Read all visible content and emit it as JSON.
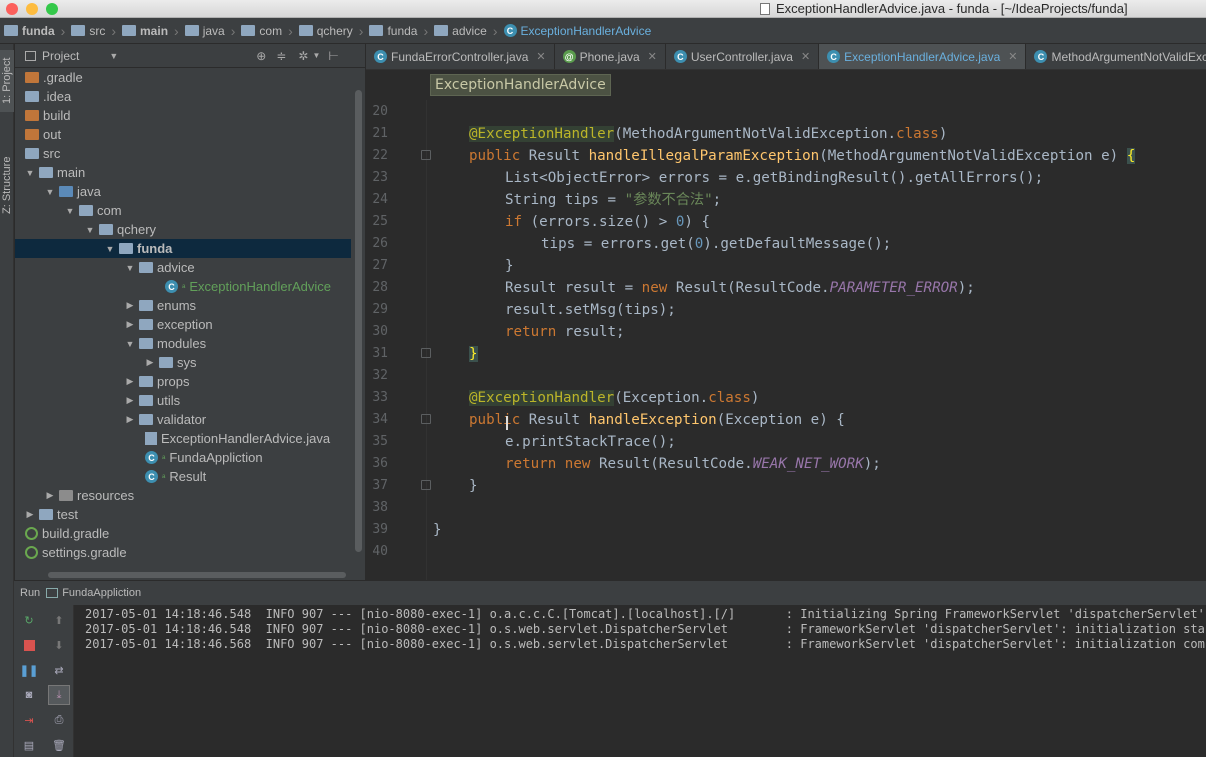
{
  "window": {
    "title": "ExceptionHandlerAdvice.java - funda - [~/IdeaProjects/funda]"
  },
  "breadcrumbs": [
    "funda",
    "src",
    "main",
    "java",
    "com",
    "qchery",
    "funda",
    "advice",
    "ExceptionHandlerAdvice"
  ],
  "left_strip": {
    "project_tab": "1: Project",
    "structure_tab": "Z: Structure"
  },
  "project_panel": {
    "title": "Project"
  },
  "tree": [
    {
      "label": ".gradle"
    },
    {
      "label": ".idea"
    },
    {
      "label": "build"
    },
    {
      "label": "out"
    },
    {
      "label": "src"
    },
    {
      "label": "main"
    },
    {
      "label": "java"
    },
    {
      "label": "com"
    },
    {
      "label": "qchery"
    },
    {
      "label": "funda"
    },
    {
      "label": "advice"
    },
    {
      "label": "ExceptionHandlerAdvice"
    },
    {
      "label": "enums"
    },
    {
      "label": "exception"
    },
    {
      "label": "modules"
    },
    {
      "label": "sys"
    },
    {
      "label": "props"
    },
    {
      "label": "utils"
    },
    {
      "label": "validator"
    },
    {
      "label": "ExceptionHandlerAdvice.java"
    },
    {
      "label": "FundaAppliction"
    },
    {
      "label": "Result"
    },
    {
      "label": "resources"
    },
    {
      "label": "test"
    },
    {
      "label": "build.gradle"
    },
    {
      "label": "settings.gradle"
    }
  ],
  "tabs": [
    "FundaErrorController.java",
    "Phone.java",
    "UserController.java",
    "ExceptionHandlerAdvice.java",
    "MethodArgumentNotValidExceptio"
  ],
  "editor": {
    "class_crumb": "ExceptionHandlerAdvice"
  },
  "line_numbers": [
    "20",
    "21",
    "22",
    "23",
    "24",
    "25",
    "26",
    "27",
    "28",
    "29",
    "30",
    "31",
    "32",
    "33",
    "34",
    "35",
    "36",
    "37",
    "38",
    "39",
    "40"
  ],
  "code": {
    "l21_ann": "@ExceptionHandler",
    "l21_rest": "(MethodArgumentNotValidException.",
    "l21_kw": "class",
    "l21_end": ")",
    "l22_kw": "public",
    "l22_a": " Result ",
    "l22_fn": "handleIllegalParamException",
    "l22_b": "(MethodArgumentNotValidException e) ",
    "l22_brace": "{",
    "l23": "List<ObjectError> errors = e.getBindingResult().getAllErrors();",
    "l24_a": "String tips = ",
    "l24_str": "\"参数不合法\"",
    "l24_b": ";",
    "l25_kw": "if",
    "l25_a": " (errors.size() > ",
    "l25_num": "0",
    "l25_b": ") {",
    "l26_a": "tips = errors.get(",
    "l26_num": "0",
    "l26_b": ").getDefaultMessage();",
    "l27": "}",
    "l28_a": "Result result = ",
    "l28_kw": "new",
    "l28_b": " Result(ResultCode.",
    "l28_st": "PARAMETER_ERROR",
    "l28_c": ");",
    "l29": "result.setMsg(tips);",
    "l30_kw": "return",
    "l30_a": " result;",
    "l31": "}",
    "l33_ann": "@ExceptionHandler",
    "l33_rest": "(Exception.",
    "l33_kw": "class",
    "l33_end": ")",
    "l34_kw": "public",
    "l34_a": " Result ",
    "l34_fn": "handleException",
    "l34_b": "(Exception e) {",
    "l35": "e.printStackTrace();",
    "l36_kw": "return new",
    "l36_a": " Result(ResultCode.",
    "l36_st": "WEAK_NET_WORK",
    "l36_b": ");",
    "l37": "}",
    "l39": "}"
  },
  "run_panel": {
    "label": "Run",
    "config": "FundaAppliction"
  },
  "console": [
    "2017-05-01 14:18:46.548  INFO 907 --- [nio-8080-exec-1] o.a.c.c.C.[Tomcat].[localhost].[/]       : Initializing Spring FrameworkServlet 'dispatcherServlet'",
    "2017-05-01 14:18:46.548  INFO 907 --- [nio-8080-exec-1] o.s.web.servlet.DispatcherServlet        : FrameworkServlet 'dispatcherServlet': initialization started",
    "2017-05-01 14:18:46.568  INFO 907 --- [nio-8080-exec-1] o.s.web.servlet.DispatcherServlet        : FrameworkServlet 'dispatcherServlet': initialization completed"
  ],
  "colors": {
    "editor_bg": "#2b2b2b",
    "panel_bg": "#3c3f41",
    "selection": "#0d293e",
    "keyword": "#cc7832",
    "annotation": "#bbb529",
    "method": "#ffc66d",
    "string": "#6a8759",
    "number": "#6897bb",
    "static_field": "#9876aa"
  }
}
